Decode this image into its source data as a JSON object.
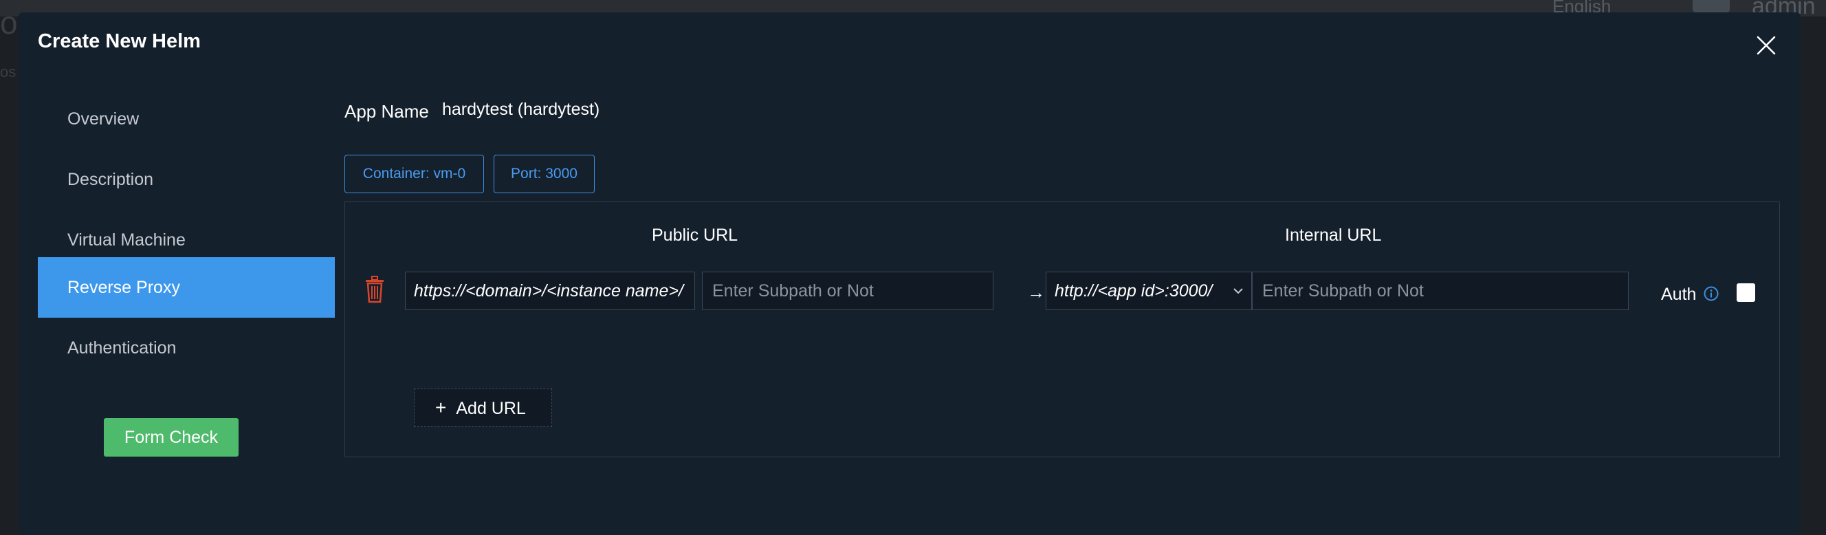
{
  "background": {
    "left_text": "op",
    "left_sub": "os",
    "language": "English",
    "user": "admin"
  },
  "modal": {
    "title": "Create New Helm",
    "close_icon": "close-icon"
  },
  "nav": {
    "items": [
      {
        "label": "Overview",
        "active": false
      },
      {
        "label": "Description",
        "active": false
      },
      {
        "label": "Virtual Machine",
        "active": false
      },
      {
        "label": "Reverse Proxy",
        "active": true
      },
      {
        "label": "Authentication",
        "active": false
      }
    ],
    "form_check_label": "Form Check"
  },
  "app": {
    "name_label": "App Name",
    "name_value": "hardytest (hardytest)"
  },
  "tags": {
    "container": "Container: vm-0",
    "port": "Port: 3000"
  },
  "proxy": {
    "public_header": "Public URL",
    "internal_header": "Internal URL",
    "public_prefix": "https://<domain>/<instance name>/",
    "public_placeholder": "Enter Subpath or Not",
    "arrow": "→",
    "internal_prefix": "http://<app id>:3000/",
    "internal_placeholder": "Enter Subpath or Not",
    "auth_label": "Auth",
    "auth_checked": false,
    "add_url_label": "Add URL"
  },
  "colors": {
    "modal_bg": "#15202d",
    "active_nav": "#3d98ec",
    "success": "#4eba6c",
    "tag_border": "#3d8fe0",
    "trash": "#d8452b"
  }
}
